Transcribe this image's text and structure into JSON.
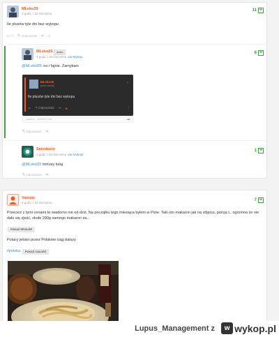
{
  "post1": {
    "username": "MLeko29",
    "meta": "3 godz. / 22 min temu",
    "body": "Ile plusów tyle dni bez wykopu",
    "votes": "11",
    "comments_count": "7",
    "reply_label": "Odpowiedz"
  },
  "reply1": {
    "username": "MLeko29",
    "author_badge": "Autor",
    "meta_time": "3 godz. / 20 min temu",
    "meta_via": "via Wykop",
    "mention": "@MLeko29",
    "body": ": no i fajnie. Zamykam",
    "votes": "8",
    "reply_label": "Odpowiedz",
    "embed": {
      "username": "MLeko29",
      "meta": "przed chwilą",
      "body": "Ile plusów tyle dni bez wykopu",
      "reply_label": "Odpowiedz"
    },
    "source_text": "pobierz · 1000007744",
    "colors": {
      "embed_bg": "#2b2b2b"
    }
  },
  "reply2": {
    "username": "Smerfusty",
    "meta_time": "1 godz. / 51 min temu",
    "meta_via": "via Android",
    "mention": "@MLeko29",
    "body": " minusy tutaj",
    "votes": "1",
    "reply_label": "Odpowiedz"
  },
  "post2": {
    "username": "Vampiz",
    "meta": "3 godz. / 22 min temu",
    "votes": "7",
    "body1": "Przecież z tymi cenami to wiadomo nie od dziś. Na początku tego miesiąca byłem w Pizie. Taki oto makaron jak na zdjęciu, porcja L, ogromna że nie dało się zjeść, około 200g samego makaron za...",
    "spoiler_label": "POKAŻ SPOILER",
    "body2": "Polacy jebani przez Polaków ciąg dalszy",
    "tag": "#polska",
    "show_all_label": "POKAŻ CAŁOŚĆ"
  },
  "footer": {
    "watermark": "Lupus_Management z",
    "logo_text": "wykop.pl"
  },
  "colors": {
    "accent": "#ff5917",
    "green": "#3aa63a",
    "link": "#3c8dcf"
  }
}
